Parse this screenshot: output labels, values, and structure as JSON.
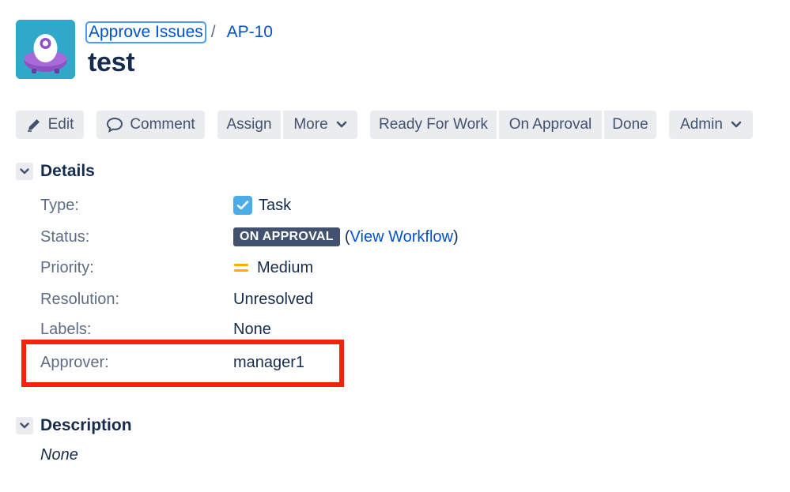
{
  "header": {
    "project_icon": "project-avatar-icon",
    "breadcrumb": {
      "project": "Approve Issues",
      "separator": "/",
      "issue_key": "AP-10"
    },
    "title": "test"
  },
  "toolbar": {
    "edit": "Edit",
    "comment": "Comment",
    "assign": "Assign",
    "more": "More",
    "ready_for_work": "Ready For Work",
    "on_approval": "On Approval",
    "done": "Done",
    "admin": "Admin"
  },
  "details": {
    "title": "Details",
    "fields": {
      "type": {
        "label": "Type:",
        "value": "Task"
      },
      "status": {
        "label": "Status:",
        "value": "ON APPROVAL",
        "open_paren": "(",
        "link": "View Workflow",
        "close_paren": ")"
      },
      "priority": {
        "label": "Priority:",
        "value": "Medium"
      },
      "resolution": {
        "label": "Resolution:",
        "value": "Unresolved"
      },
      "labels": {
        "label": "Labels:",
        "value": "None"
      },
      "approver": {
        "label": "Approver:",
        "value": "manager1"
      }
    }
  },
  "description": {
    "title": "Description",
    "value": "None"
  },
  "colors": {
    "accent": "#0052cc",
    "highlight": "#f5230c",
    "lozenge": "#42526e",
    "priority_medium": "#ffab00",
    "task": "#4bade8"
  }
}
